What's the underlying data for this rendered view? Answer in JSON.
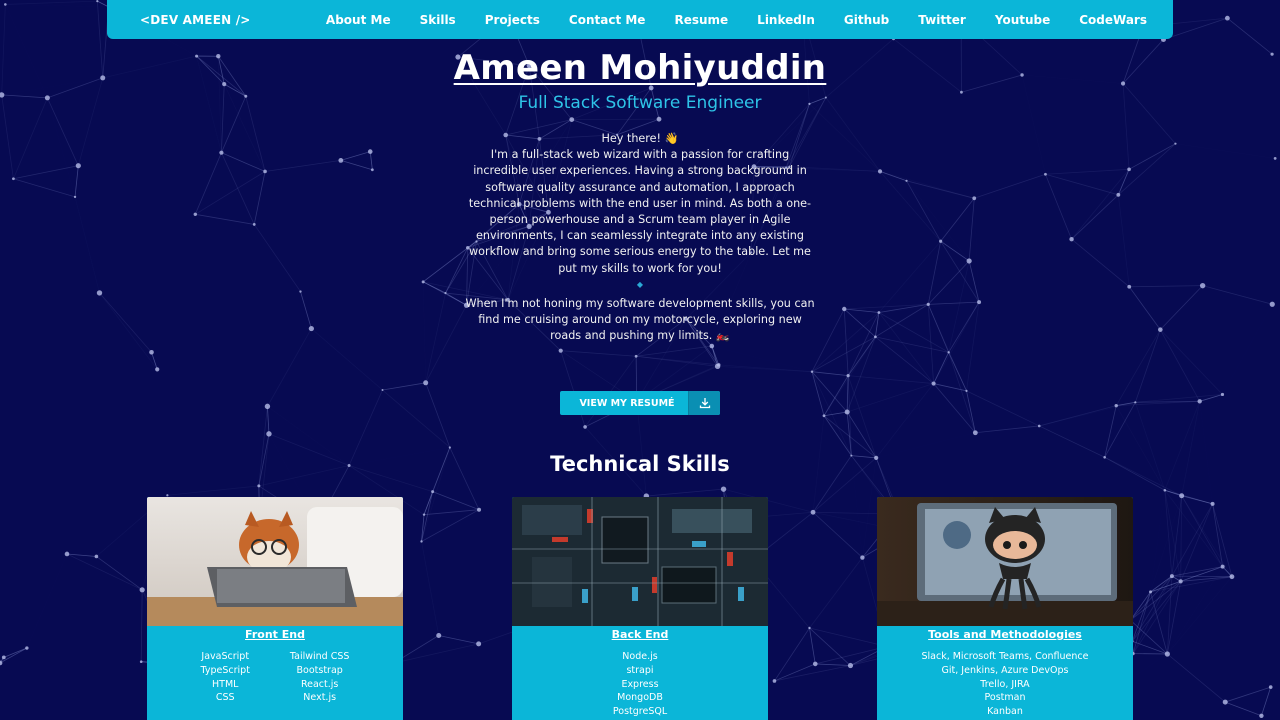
{
  "nav": {
    "brand": "<DEV AMEEN />",
    "links": [
      "About Me",
      "Skills",
      "Projects",
      "Contact Me",
      "Resume",
      "LinkedIn",
      "Github",
      "Twitter",
      "Youtube",
      "CodeWars"
    ]
  },
  "hero": {
    "name": "Ameen Mohiyuddin",
    "role": "Full Stack Software Engineer",
    "greeting": "Hey there! 👋",
    "intro": "I'm a full-stack web wizard with a passion for crafting incredible user experiences. Having a strong background in software quality assurance and automation, I approach technical problems with the end user in mind. As both a one-person powerhouse and a Scrum team player in Agile environments, I can seamlessly integrate into any existing workflow and bring some serious energy to the table. Let me put my skills to work for you!",
    "divider": "◆",
    "intro2": "When I'm not honing my software development skills, you can find me cruising around on my motorcycle, exploring new roads and pushing my limits. 🏍️",
    "resume_button": "VIEW MY RESUMÉ",
    "resume_icon": "download-icon"
  },
  "skills": {
    "title": "Technical Skills",
    "cards": [
      {
        "title": "Front End",
        "image": "dog-with-laptop",
        "columns": [
          [
            "JavaScript",
            "TypeScript",
            "HTML",
            "CSS"
          ],
          [
            "Tailwind CSS",
            "Bootstrap",
            "React.js",
            "Next.js"
          ]
        ]
      },
      {
        "title": "Back End",
        "image": "circuit-board",
        "columns": [
          [
            "Node.js",
            "strapi",
            "Express",
            "MongoDB",
            "PostgreSQL"
          ]
        ]
      },
      {
        "title": "Tools and Methodologies",
        "image": "octocat-figure",
        "columns": [
          [
            "Slack, Microsoft Teams, Confluence",
            "Git, Jenkins, Azure DevOps",
            "Trello, JIRA",
            "Postman",
            "Kanban"
          ]
        ]
      }
    ]
  },
  "colors": {
    "background": "#070a52",
    "accent": "#0bb6d8",
    "role_text": "#2ec4e8"
  }
}
